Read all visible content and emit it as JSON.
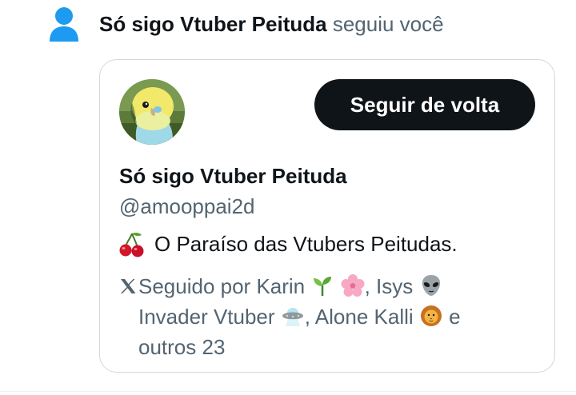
{
  "notification": {
    "actor_name": "Só sigo Vtuber Peituda",
    "action_text": " seguiu você",
    "icon": "person-icon"
  },
  "card": {
    "display_name": "Só sigo Vtuber Peituda",
    "handle": "@amooppai2d",
    "follow_back_label": "Seguir de volta",
    "bio_emoji": "cherry-icon",
    "bio_text": "O Paraíso das Vtubers Peitudas.",
    "followed_by": {
      "line1_prefix": "Seguido por Karin",
      "line1_middle": ", Isys",
      "line2_prefix": "Invader Vtuber",
      "line2_middle": ", Alone Kalli",
      "line2_suffix": " e",
      "line3": "outros 23"
    }
  },
  "colors": {
    "text_primary": "#0f1419",
    "text_secondary": "#536471",
    "button_bg": "#0f1419",
    "button_text": "#ffffff",
    "icon_blue": "#1d9bf0",
    "card_border": "#cfd9de"
  }
}
